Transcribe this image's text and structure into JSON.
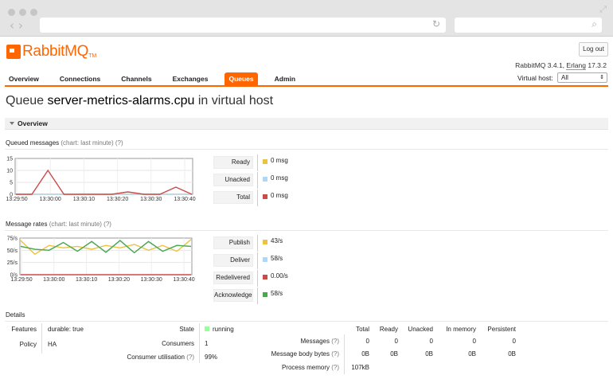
{
  "header": {
    "logo_text": "RabbitMQ",
    "logo_tm": "TM",
    "logout_label": "Log out",
    "version_prefix": "RabbitMQ 3.4.1, ",
    "erlang_label": "Erlang",
    "erlang_version": " 17.3.2"
  },
  "nav": {
    "tabs": [
      "Overview",
      "Connections",
      "Channels",
      "Exchanges",
      "Queues",
      "Admin"
    ],
    "active": "Queues"
  },
  "vhost": {
    "label": "Virtual host:",
    "selected": "All"
  },
  "page": {
    "title_prefix": "Queue ",
    "queue_name": "server-metrics-alarms.cpu",
    "title_suffix": " in virtual host"
  },
  "overview": {
    "section_label": "Overview",
    "queued_heading": "Queued messages",
    "queued_note": "(chart: last minute) (?)",
    "rates_heading": "Message rates",
    "rates_note": "(chart: last minute) (?)",
    "queued_legend": [
      {
        "label": "Ready",
        "value": "0 msg",
        "color": "#edc240"
      },
      {
        "label": "Unacked",
        "value": "0 msg",
        "color": "#afd8f8"
      },
      {
        "label": "Total",
        "value": "0 msg",
        "color": "#cb4b4b"
      }
    ],
    "rates_legend": [
      {
        "label": "Publish",
        "value": "43/s",
        "color": "#edc240"
      },
      {
        "label": "Deliver",
        "value": "58/s",
        "color": "#afd8f8"
      },
      {
        "label": "Redelivered",
        "value": "0.00/s",
        "color": "#cb4b4b"
      },
      {
        "label": "Acknowledge",
        "value": "58/s",
        "color": "#4da74d"
      }
    ]
  },
  "chart_data": [
    {
      "type": "line",
      "yticks": [
        "15",
        "10",
        "5",
        "0"
      ],
      "ylim": [
        0,
        15
      ],
      "xticks": [
        "13:29:50",
        "13:30:00",
        "13:30:10",
        "13:30:20",
        "13:30:30",
        "13:30:40"
      ],
      "grid": true,
      "series": [
        {
          "name": "Ready",
          "color": "#edc240",
          "values": [
            0,
            0,
            0,
            0,
            0,
            0,
            0,
            0,
            0,
            0,
            0,
            0
          ]
        },
        {
          "name": "Unacked",
          "color": "#afd8f8",
          "values": [
            0,
            0,
            0,
            0,
            0,
            0,
            0,
            0,
            0,
            0,
            0,
            0
          ]
        },
        {
          "name": "Total",
          "color": "#cb4b4b",
          "values": [
            0,
            0,
            10,
            0,
            0,
            0,
            0,
            1,
            0,
            0,
            3,
            0
          ]
        }
      ]
    },
    {
      "type": "line",
      "yticks": [
        "75/s",
        "50/s",
        "25/s",
        "0/s"
      ],
      "ylim": [
        0,
        75
      ],
      "xticks": [
        "13:29:50",
        "13:30:00",
        "13:30:10",
        "13:30:20",
        "13:30:30",
        "13:30:40"
      ],
      "grid": true,
      "series": [
        {
          "name": "Publish",
          "color": "#edc240",
          "values": [
            70,
            42,
            60,
            55,
            58,
            52,
            60,
            55,
            62,
            50,
            60,
            48,
            72
          ]
        },
        {
          "name": "Deliver",
          "color": "#afd8f8",
          "values": [
            58,
            52,
            50,
            66,
            48,
            68,
            46,
            70,
            45,
            68,
            48,
            60,
            58
          ]
        },
        {
          "name": "Redelivered",
          "color": "#cb4b4b",
          "values": [
            0,
            0,
            0,
            0,
            0,
            0,
            0,
            0,
            0,
            0,
            0,
            0,
            0
          ]
        },
        {
          "name": "Acknowledge",
          "color": "#4da74d",
          "values": [
            58,
            52,
            50,
            66,
            48,
            68,
            46,
            70,
            45,
            68,
            48,
            60,
            58
          ]
        }
      ]
    }
  ],
  "details": {
    "heading": "Details",
    "features_label": "Features",
    "features_key": "durable:",
    "features_value": "true",
    "policy_label": "Policy",
    "policy_value": "HA",
    "state_label": "State",
    "state_value": "running",
    "consumers_label": "Consumers",
    "consumers_value": "1",
    "utilisation_label": "Consumer utilisation",
    "utilisation_help": "(?)",
    "utilisation_value": "99%",
    "stats_headers": [
      "Total",
      "Ready",
      "Unacked",
      "In memory",
      "Persistent"
    ],
    "messages_label": "Messages",
    "messages_help": "(?)",
    "messages_values": [
      "0",
      "0",
      "0",
      "0",
      "0"
    ],
    "body_bytes_label": "Message body bytes",
    "body_bytes_help": "(?)",
    "body_bytes_values": [
      "0B",
      "0B",
      "0B",
      "0B",
      "0B"
    ],
    "process_memory_label": "Process memory",
    "process_memory_help": "(?)",
    "process_memory_value": "107kB"
  }
}
